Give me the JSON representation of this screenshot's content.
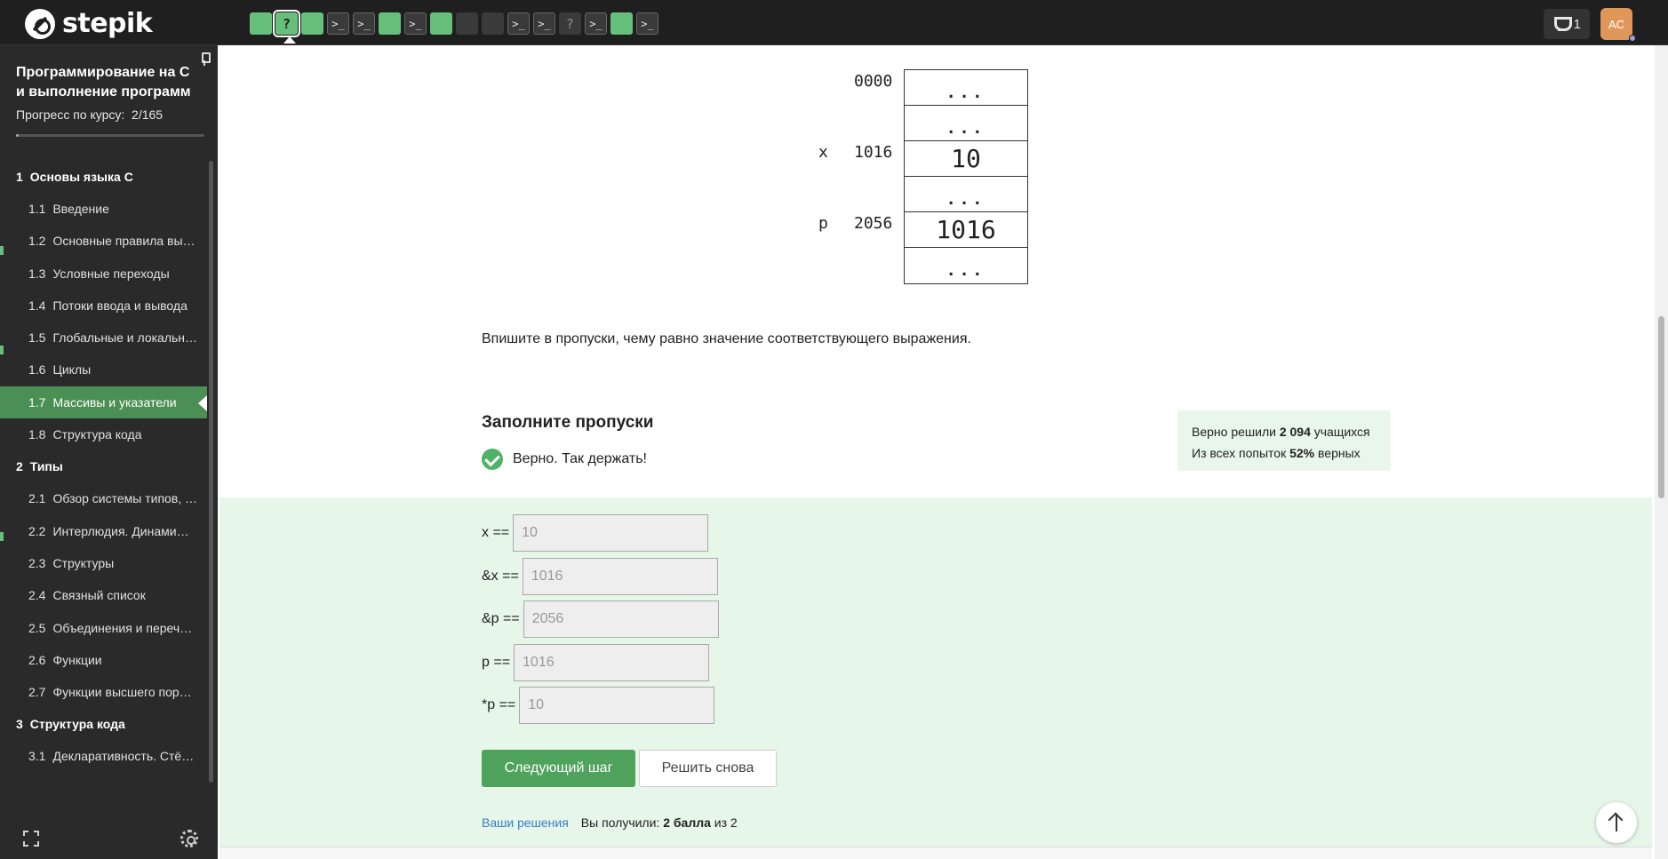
{
  "brand": {
    "name": "stepik"
  },
  "step_bar": [
    {
      "kind": "green"
    },
    {
      "kind": "green-q",
      "glyph": "?"
    },
    {
      "kind": "green"
    },
    {
      "kind": "term"
    },
    {
      "kind": "term"
    },
    {
      "kind": "green"
    },
    {
      "kind": "term"
    },
    {
      "kind": "green"
    },
    {
      "kind": "dark"
    },
    {
      "kind": "dark"
    },
    {
      "kind": "term"
    },
    {
      "kind": "term"
    },
    {
      "kind": "q",
      "glyph": "?"
    },
    {
      "kind": "term"
    },
    {
      "kind": "green"
    },
    {
      "kind": "term"
    }
  ],
  "header": {
    "points": "1",
    "avatar_initials": "AC"
  },
  "sidebar": {
    "course_title": "Программирование на C и выполнение программ",
    "progress_label": "Прогресс по курсу:",
    "progress_value": "2/165",
    "progress_fraction": 0.012,
    "sections": [
      {
        "num": "1",
        "title": "Основы языка C",
        "lessons": [
          {
            "num": "1.1",
            "title": "Введение"
          },
          {
            "num": "1.2",
            "title": "Основные правила вы…"
          },
          {
            "num": "1.3",
            "title": "Условные переходы"
          },
          {
            "num": "1.4",
            "title": "Потоки ввода и вывода"
          },
          {
            "num": "1.5",
            "title": "Глобальные и локальн…"
          },
          {
            "num": "1.6",
            "title": "Циклы"
          },
          {
            "num": "1.7",
            "title": "Массивы и указатели",
            "active": true
          },
          {
            "num": "1.8",
            "title": "Структура кода"
          }
        ]
      },
      {
        "num": "2",
        "title": "Типы",
        "lessons": [
          {
            "num": "2.1",
            "title": "Обзор системы типов, …"
          },
          {
            "num": "2.2",
            "title": "Интерлюдия. Динами…"
          },
          {
            "num": "2.3",
            "title": "Структуры"
          },
          {
            "num": "2.4",
            "title": "Связный список"
          },
          {
            "num": "2.5",
            "title": "Объединения и переч…"
          },
          {
            "num": "2.6",
            "title": "Функции"
          },
          {
            "num": "2.7",
            "title": "Функции высшего пор…"
          }
        ]
      },
      {
        "num": "3",
        "title": "Структура кода",
        "lessons": [
          {
            "num": "3.1",
            "title": "Декларативность. Стё…"
          }
        ]
      }
    ]
  },
  "memory_diagram": {
    "cells": [
      {
        "kind": "dots",
        "text": "..."
      },
      {
        "kind": "dots",
        "text": "..."
      },
      {
        "kind": "val",
        "text": "10"
      },
      {
        "kind": "dots",
        "text": "..."
      },
      {
        "kind": "val",
        "text": "1016"
      },
      {
        "kind": "dots",
        "text": "..."
      }
    ],
    "labels": {
      "addr0": "0000",
      "x_name": "x",
      "x_addr": "1016",
      "p_name": "p",
      "p_addr": "2056"
    }
  },
  "task": {
    "instruction": "Впишите в пропуски, чему равно значение соответствующего выражения.",
    "title": "Заполните пропуски",
    "verdict": "Верно. Так держать!",
    "stats_line1_pre": "Верно решили ",
    "stats_line1_num": "2 094",
    "stats_line1_post": " учащихся",
    "stats_line2_pre": "Из всех попыток ",
    "stats_line2_num": "52%",
    "stats_line2_post": " верных",
    "fields": [
      {
        "label": "x ==",
        "value": "10"
      },
      {
        "label": "&x ==",
        "value": "1016"
      },
      {
        "label": "&p ==",
        "value": "2056"
      },
      {
        "label": "p ==",
        "value": "1016"
      },
      {
        "label": "*p ==",
        "value": "10"
      }
    ],
    "next_button": "Следующий шаг",
    "retry_button": "Решить снова",
    "solutions_link": "Ваши решения",
    "score_pre": "Вы получили: ",
    "score_value": "2 балла",
    "score_post": " из 2"
  },
  "colors": {
    "accent": "#4fa35c",
    "success_bg": "#e6f6e9",
    "topbar": "#1f1f1f",
    "sidebar": "#2a2a2a"
  }
}
